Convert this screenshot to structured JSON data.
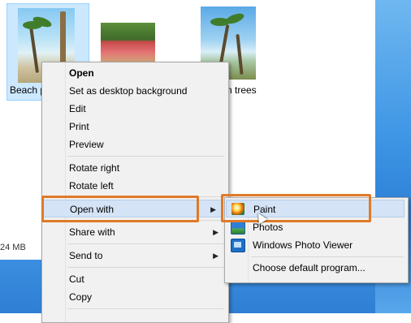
{
  "files": [
    {
      "name": "Beach p",
      "selected": true
    },
    {
      "name": "",
      "selected": false
    },
    {
      "name": "n trees",
      "selected": false
    }
  ],
  "status": {
    "size_text": "24 MB"
  },
  "context_menu": {
    "items": [
      {
        "label": "Open",
        "bold": true
      },
      {
        "label": "Set as desktop background"
      },
      {
        "label": "Edit"
      },
      {
        "label": "Print"
      },
      {
        "label": "Preview"
      },
      {
        "label": "Rotate right"
      },
      {
        "label": "Rotate left"
      },
      {
        "label": "Open with",
        "has_submenu": true,
        "highlighted": true
      },
      {
        "label": "Share with",
        "has_submenu": true
      },
      {
        "label": "Send to",
        "has_submenu": true
      },
      {
        "label": "Cut"
      },
      {
        "label": "Copy"
      }
    ],
    "submenu_arrow": "▶"
  },
  "open_with_submenu": {
    "items": [
      {
        "label": "Paint",
        "icon": "paint-icon",
        "highlighted": true
      },
      {
        "label": "Photos",
        "icon": "photos-icon"
      },
      {
        "label": "Windows Photo Viewer",
        "icon": "photo-viewer-icon"
      },
      {
        "label": "Choose default program..."
      }
    ]
  },
  "colors": {
    "highlight_box": "#e07a27",
    "menu_hover": "#d4e3f6",
    "selection": "#cce8ff",
    "desktop_blue": "#2f7fd4"
  }
}
